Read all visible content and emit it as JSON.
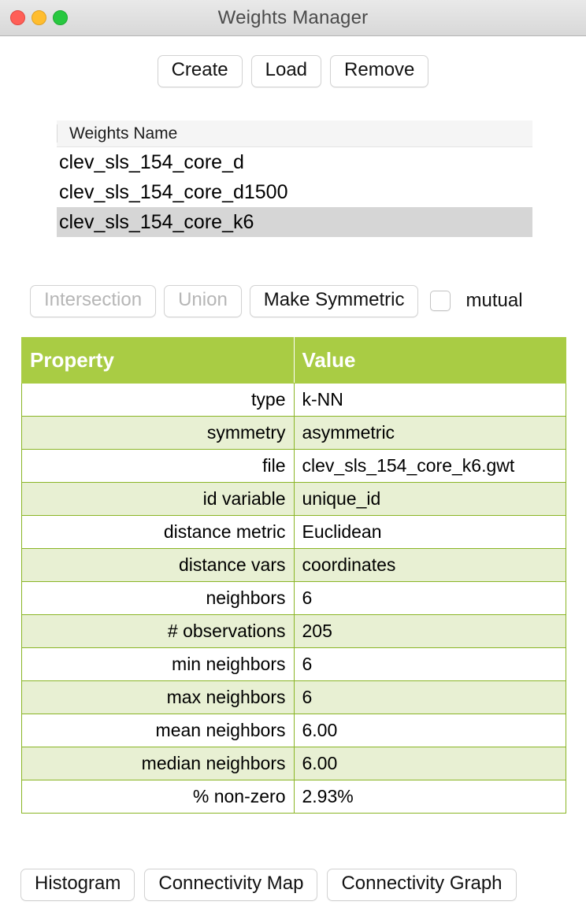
{
  "window": {
    "title": "Weights Manager",
    "controls": {
      "close": "close",
      "minimize": "minimize",
      "maximize": "maximize"
    }
  },
  "toolbar_top": {
    "create_label": "Create",
    "load_label": "Load",
    "remove_label": "Remove"
  },
  "weights_list": {
    "column_header": "Weights Name",
    "items": [
      {
        "name": "clev_sls_154_core_d",
        "selected": false
      },
      {
        "name": "clev_sls_154_core_d1500",
        "selected": false
      },
      {
        "name": "clev_sls_154_core_k6",
        "selected": true
      }
    ]
  },
  "set_ops": {
    "intersection_label": "Intersection",
    "intersection_enabled": false,
    "union_label": "Union",
    "union_enabled": false,
    "make_symmetric_label": "Make Symmetric",
    "make_symmetric_enabled": true,
    "mutual_label": "mutual",
    "mutual_checked": false
  },
  "properties": {
    "header_property": "Property",
    "header_value": "Value",
    "rows": [
      {
        "key": "type",
        "value": "k-NN"
      },
      {
        "key": "symmetry",
        "value": "asymmetric"
      },
      {
        "key": "file",
        "value": "clev_sls_154_core_k6.gwt"
      },
      {
        "key": "id variable",
        "value": "unique_id"
      },
      {
        "key": "distance metric",
        "value": "Euclidean"
      },
      {
        "key": "distance vars",
        "value": "coordinates"
      },
      {
        "key": "neighbors",
        "value": "6"
      },
      {
        "key": "# observations",
        "value": "205"
      },
      {
        "key": "min neighbors",
        "value": "6"
      },
      {
        "key": "max neighbors",
        "value": "6"
      },
      {
        "key": "mean neighbors",
        "value": "6.00"
      },
      {
        "key": "median neighbors",
        "value": "6.00"
      },
      {
        "key": "% non-zero",
        "value": "2.93%"
      }
    ]
  },
  "toolbar_bottom": {
    "histogram_label": "Histogram",
    "connectivity_map_label": "Connectivity Map",
    "connectivity_graph_label": "Connectivity Graph"
  },
  "colors": {
    "table_header_green": "#a9cc44",
    "table_row_green": "#e8f0d3",
    "table_border_green": "#8ab525",
    "selection_gray": "#d6d6d6",
    "traffic_red": "#ff5f57",
    "traffic_yellow": "#ffbd2e",
    "traffic_green": "#28c840"
  }
}
